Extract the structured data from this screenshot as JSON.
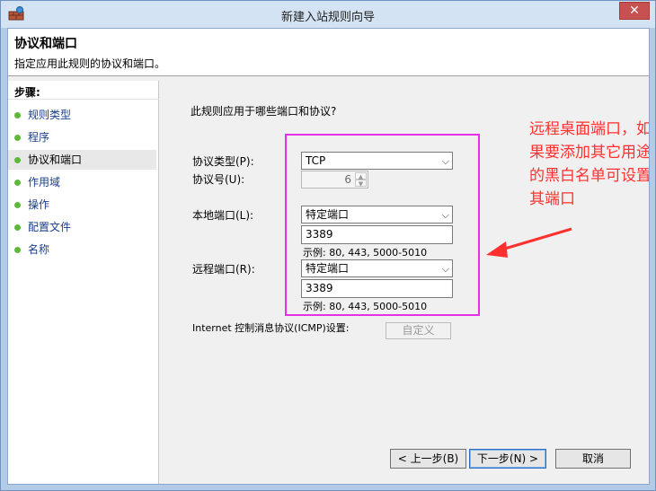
{
  "window": {
    "title": "新建入站规则向导"
  },
  "header": {
    "title": "协议和端口",
    "subtitle": "指定应用此规则的协议和端口。"
  },
  "steps": {
    "title": "步骤:",
    "items": [
      {
        "label": "规则类型"
      },
      {
        "label": "程序"
      },
      {
        "label": "协议和端口"
      },
      {
        "label": "作用域"
      },
      {
        "label": "操作"
      },
      {
        "label": "配置文件"
      },
      {
        "label": "名称"
      }
    ]
  },
  "main": {
    "question": "此规则应用于哪些端口和协议?",
    "protocol_type": {
      "label": "协议类型(P):",
      "value": "TCP"
    },
    "protocol_number": {
      "label": "协议号(U):",
      "value": "6"
    },
    "local_port": {
      "label": "本地端口(L):",
      "select_value": "特定端口",
      "input_value": "3389",
      "example": "示例: 80, 443, 5000-5010"
    },
    "remote_port": {
      "label": "远程端口(R):",
      "select_value": "特定端口",
      "input_value": "3389",
      "example": "示例: 80, 443, 5000-5010"
    },
    "icmp": {
      "label": "Internet 控制消息协议(ICMP)设置:",
      "button": "自定义"
    }
  },
  "buttons": {
    "back": "< 上一步(B)",
    "next": "下一步(N) >",
    "cancel": "取消"
  },
  "annotation": {
    "text": "远程桌面端口，如果要添加其它用途的黑白名单可设置其端口"
  },
  "colors": {
    "highlight": "#e630e6",
    "annotation": "#ff3030",
    "step_dot": "#5fb83a"
  }
}
